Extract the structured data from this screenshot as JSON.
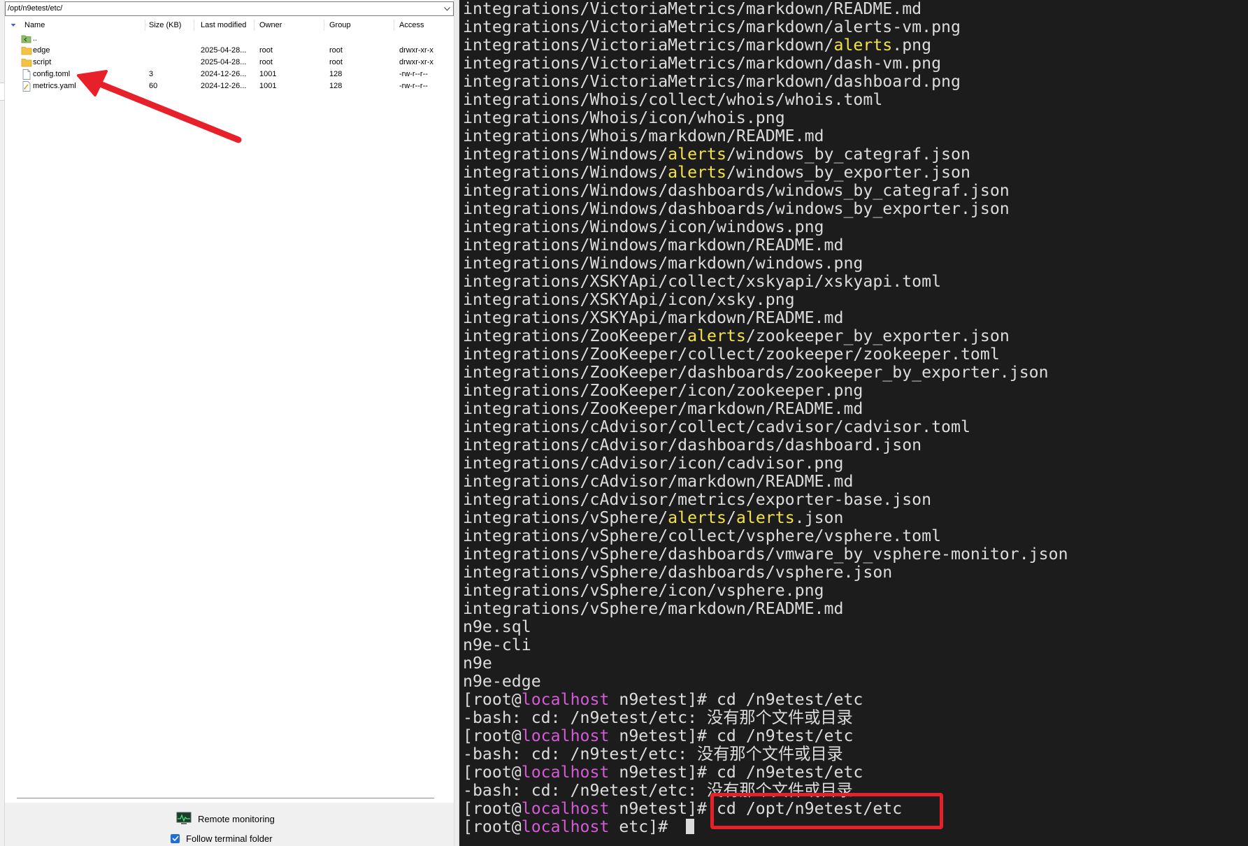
{
  "file_browser": {
    "path": "/opt/n9etest/etc/",
    "columns": {
      "name": "Name",
      "size": "Size (KB)",
      "modified": "Last modified",
      "owner": "Owner",
      "group": "Group",
      "access": "Access"
    },
    "parent_label": "..",
    "rows": [
      {
        "name": "edge",
        "size": "",
        "modified": "2025-04-28...",
        "owner": "root",
        "group": "root",
        "access": "drwxr-xr-x",
        "icon": "folder-icon"
      },
      {
        "name": "script",
        "size": "",
        "modified": "2025-04-28...",
        "owner": "root",
        "group": "root",
        "access": "drwxr-xr-x",
        "icon": "folder-icon"
      },
      {
        "name": "config.toml",
        "size": "3",
        "modified": "2024-12-26...",
        "owner": "1001",
        "group": "128",
        "access": "-rw-r--r--",
        "icon": "file-icon"
      },
      {
        "name": "metrics.yaml",
        "size": "60",
        "modified": "2024-12-26...",
        "owner": "1001",
        "group": "128",
        "access": "-rw-r--r--",
        "icon": "yaml-file-icon"
      }
    ],
    "remote_monitoring_label": "Remote monitoring",
    "follow_terminal_label": "Follow terminal folder",
    "follow_terminal_checked": true
  },
  "terminal": {
    "lines": [
      [
        {
          "t": "integrations/VictoriaMetrics/markdown/README.md"
        }
      ],
      [
        {
          "t": "integrations/VictoriaMetrics/markdown/alerts-vm.png"
        }
      ],
      [
        {
          "t": "integrations/VictoriaMetrics/markdown/"
        },
        {
          "t": "alerts",
          "c": "yel"
        },
        {
          "t": ".png"
        }
      ],
      [
        {
          "t": "integrations/VictoriaMetrics/markdown/dash-vm.png"
        }
      ],
      [
        {
          "t": "integrations/VictoriaMetrics/markdown/dashboard.png"
        }
      ],
      [
        {
          "t": "integrations/Whois/collect/whois/whois.toml"
        }
      ],
      [
        {
          "t": "integrations/Whois/icon/whois.png"
        }
      ],
      [
        {
          "t": "integrations/Whois/markdown/README.md"
        }
      ],
      [
        {
          "t": "integrations/Windows/"
        },
        {
          "t": "alerts",
          "c": "yel"
        },
        {
          "t": "/windows_by_categraf.json"
        }
      ],
      [
        {
          "t": "integrations/Windows/"
        },
        {
          "t": "alerts",
          "c": "yel"
        },
        {
          "t": "/windows_by_exporter.json"
        }
      ],
      [
        {
          "t": "integrations/Windows/dashboards/windows_by_categraf.json"
        }
      ],
      [
        {
          "t": "integrations/Windows/dashboards/windows_by_exporter.json"
        }
      ],
      [
        {
          "t": "integrations/Windows/icon/windows.png"
        }
      ],
      [
        {
          "t": "integrations/Windows/markdown/README.md"
        }
      ],
      [
        {
          "t": "integrations/Windows/markdown/windows.png"
        }
      ],
      [
        {
          "t": "integrations/XSKYApi/collect/xskyapi/xskyapi.toml"
        }
      ],
      [
        {
          "t": "integrations/XSKYApi/icon/xsky.png"
        }
      ],
      [
        {
          "t": "integrations/XSKYApi/markdown/README.md"
        }
      ],
      [
        {
          "t": "integrations/ZooKeeper/"
        },
        {
          "t": "alerts",
          "c": "yel"
        },
        {
          "t": "/zookeeper_by_exporter.json"
        }
      ],
      [
        {
          "t": "integrations/ZooKeeper/collect/zookeeper/zookeeper.toml"
        }
      ],
      [
        {
          "t": "integrations/ZooKeeper/dashboards/zookeeper_by_exporter.json"
        }
      ],
      [
        {
          "t": "integrations/ZooKeeper/icon/zookeeper.png"
        }
      ],
      [
        {
          "t": "integrations/ZooKeeper/markdown/README.md"
        }
      ],
      [
        {
          "t": "integrations/cAdvisor/collect/cadvisor/cadvisor.toml"
        }
      ],
      [
        {
          "t": "integrations/cAdvisor/dashboards/dashboard.json"
        }
      ],
      [
        {
          "t": "integrations/cAdvisor/icon/cadvisor.png"
        }
      ],
      [
        {
          "t": "integrations/cAdvisor/markdown/README.md"
        }
      ],
      [
        {
          "t": "integrations/cAdvisor/metrics/exporter-base.json"
        }
      ],
      [
        {
          "t": "integrations/vSphere/"
        },
        {
          "t": "alerts",
          "c": "yel"
        },
        {
          "t": "/"
        },
        {
          "t": "alerts",
          "c": "yel"
        },
        {
          "t": ".json"
        }
      ],
      [
        {
          "t": "integrations/vSphere/collect/vsphere/vsphere.toml"
        }
      ],
      [
        {
          "t": "integrations/vSphere/dashboards/vmware_by_vsphere-monitor.json"
        }
      ],
      [
        {
          "t": "integrations/vSphere/dashboards/vsphere.json"
        }
      ],
      [
        {
          "t": "integrations/vSphere/icon/vsphere.png"
        }
      ],
      [
        {
          "t": "integrations/vSphere/markdown/README.md"
        }
      ],
      [
        {
          "t": "n9e.sql"
        }
      ],
      [
        {
          "t": "n9e-cli"
        }
      ],
      [
        {
          "t": "n9e"
        }
      ],
      [
        {
          "t": "n9e-edge"
        }
      ],
      [
        {
          "t": "[root@"
        },
        {
          "t": "localhost",
          "c": "mag"
        },
        {
          "t": " n9etest]# cd /n9etest/etc"
        }
      ],
      [
        {
          "t": "-bash: cd: /n9etest/etc: 没有那个文件或目录"
        }
      ],
      [
        {
          "t": "[root@"
        },
        {
          "t": "localhost",
          "c": "mag"
        },
        {
          "t": " n9etest]# cd /n9test/etc"
        }
      ],
      [
        {
          "t": "-bash: cd: /n9test/etc: 没有那个文件或目录"
        }
      ],
      [
        {
          "t": "[root@"
        },
        {
          "t": "localhost",
          "c": "mag"
        },
        {
          "t": " n9etest]# cd /n9etest/etc"
        }
      ],
      [
        {
          "t": "-bash: cd: /n9etest/etc: 没有那个文件或目录"
        }
      ],
      [
        {
          "t": "[root@"
        },
        {
          "t": "localhost",
          "c": "mag"
        },
        {
          "t": " n9etest]# cd /opt/n9etest/etc"
        }
      ],
      [
        {
          "t": "[root@"
        },
        {
          "t": "localhost",
          "c": "mag"
        },
        {
          "t": " etc]# "
        }
      ]
    ]
  },
  "colors": {
    "terminal_bg": "#1c1c1c",
    "terminal_fg": "#dcdcdc",
    "highlight_yellow": "#f2e14c",
    "host_magenta": "#d45ad6",
    "annotation_red": "#e8202a",
    "folder_yellow": "#f5c343"
  }
}
